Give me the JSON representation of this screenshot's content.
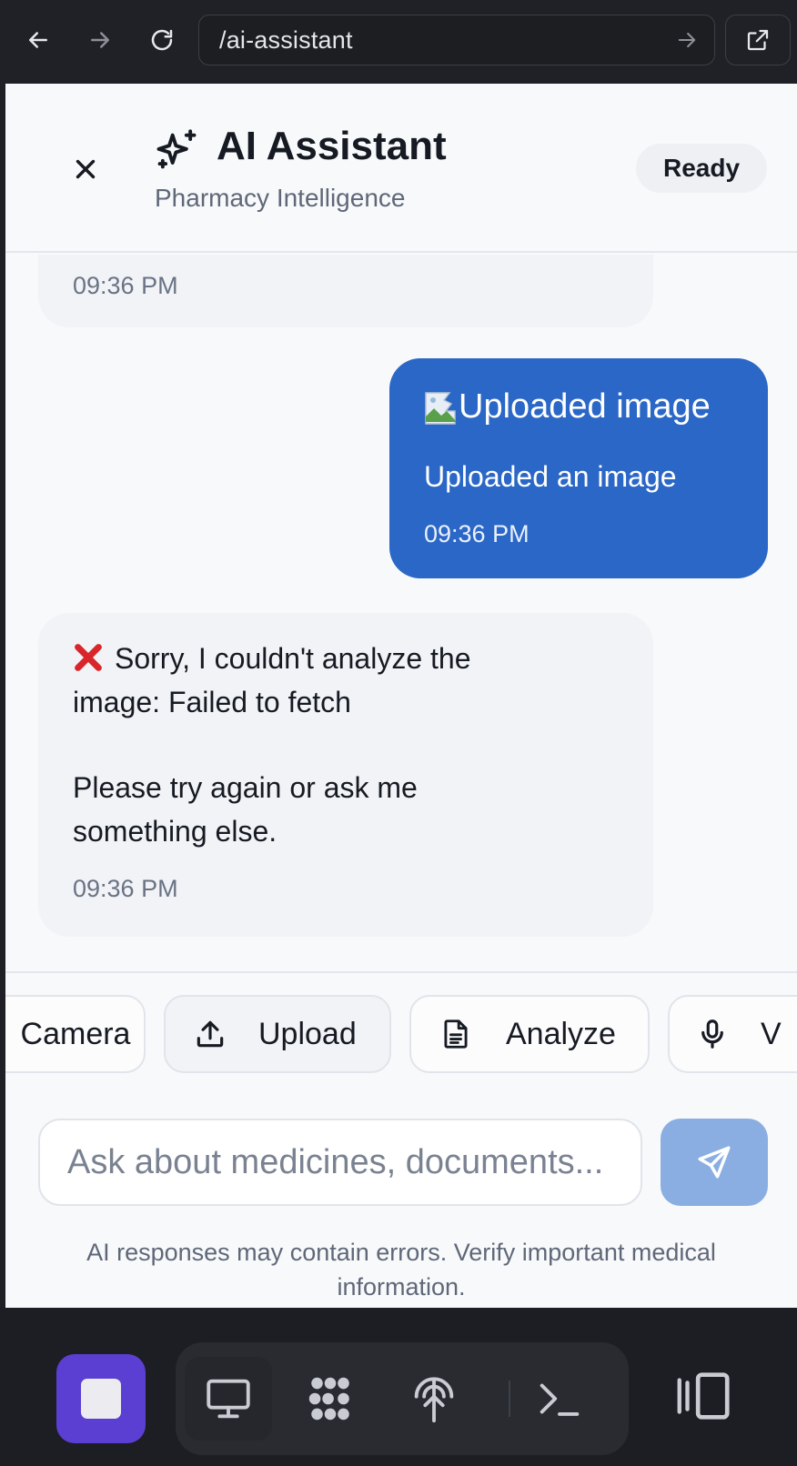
{
  "browser": {
    "url": "/ai-assistant"
  },
  "header": {
    "title": "AI Assistant",
    "subtitle": "Pharmacy Intelligence",
    "status": "Ready"
  },
  "messages": {
    "previous_ai_time": "09:36 PM",
    "user": {
      "image_alt": "Uploaded image",
      "text": "Uploaded an image",
      "time": "09:36 PM"
    },
    "ai": {
      "line1": "Sorry, I couldn't analyze the",
      "line2": "image: Failed to fetch",
      "line3": "Please try again or ask me",
      "line4": "something else.",
      "time": "09:36 PM"
    }
  },
  "actions": {
    "camera": "Camera",
    "upload": "Upload",
    "analyze": "Analyze",
    "voice": "V"
  },
  "input": {
    "placeholder": "Ask about medicines, documents...",
    "value": ""
  },
  "disclaimer": "AI responses may contain errors. Verify important medical information.",
  "colors": {
    "user_bubble": "#2b67c6",
    "send_button": "#8aaee2",
    "stop_button": "#5b3fd2",
    "error_icon": "#d8262b"
  },
  "icons": {
    "back": "arrow-left-icon",
    "forward": "arrow-right-icon",
    "reload": "reload-icon",
    "external": "external-link-icon",
    "close": "close-icon",
    "sparkle": "sparkles-icon",
    "error": "cross-mark-icon",
    "upload": "upload-icon",
    "analyze": "document-icon",
    "voice": "microphone-icon",
    "send": "send-icon",
    "stop": "stop-icon",
    "desktop": "monitor-icon",
    "apps": "apps-grid-icon",
    "network": "antenna-icon",
    "terminal": "terminal-icon",
    "panel": "side-panel-icon"
  }
}
